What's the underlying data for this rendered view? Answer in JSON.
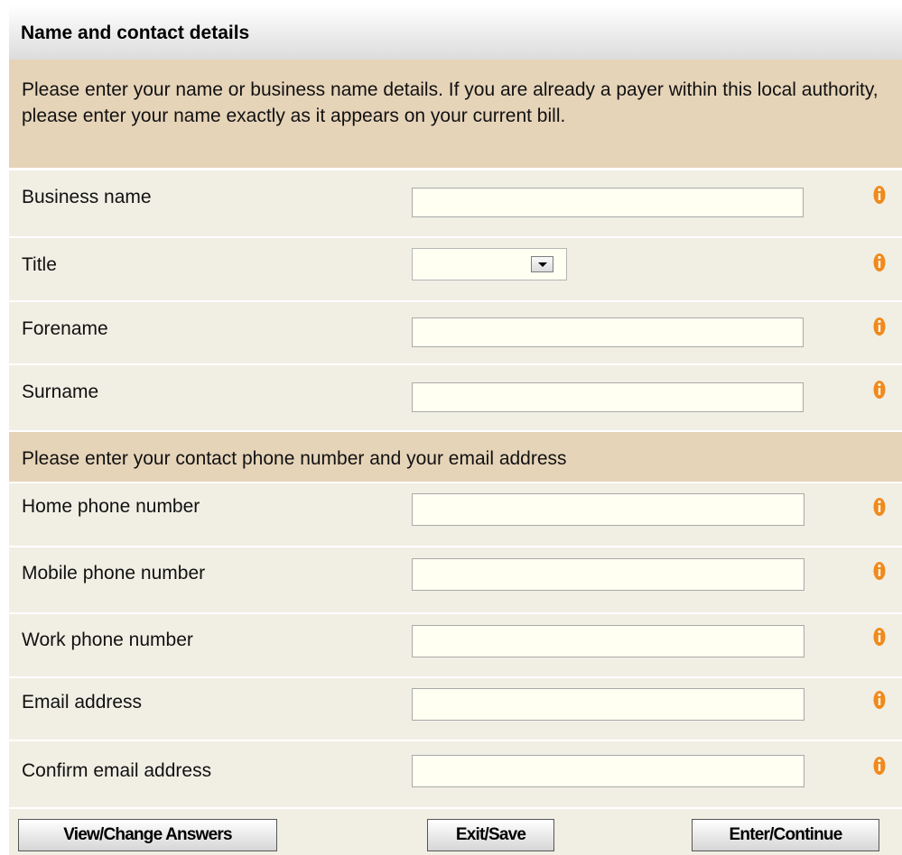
{
  "form": {
    "title": "Name and contact details",
    "intro": "Please enter your name or business name details. If you are already a payer within this local authority, please enter your name exactly as it appears on your current bill.",
    "section2": "Please enter your contact phone number and your email address",
    "fields": {
      "business_name": {
        "label": "Business name",
        "value": ""
      },
      "title": {
        "label": "Title",
        "value": ""
      },
      "forename": {
        "label": "Forename",
        "value": ""
      },
      "surname": {
        "label": "Surname",
        "value": ""
      },
      "home_phone": {
        "label": "Home phone number",
        "value": ""
      },
      "mobile_phone": {
        "label": "Mobile phone number",
        "value": ""
      },
      "work_phone": {
        "label": "Work phone number",
        "value": ""
      },
      "email": {
        "label": "Email address",
        "value": ""
      },
      "confirm_email": {
        "label": "Confirm email address",
        "value": ""
      }
    },
    "info_icon": "info-icon"
  },
  "buttons": {
    "view_change": "View/Change Answers",
    "exit_save": "Exit/Save",
    "enter_continue": "Enter/Continue"
  },
  "colors": {
    "header_band": "#e6d4b9",
    "row_background": "#f1efe4",
    "field_background": "#fffff2",
    "info_icon": "#f08a1c"
  }
}
